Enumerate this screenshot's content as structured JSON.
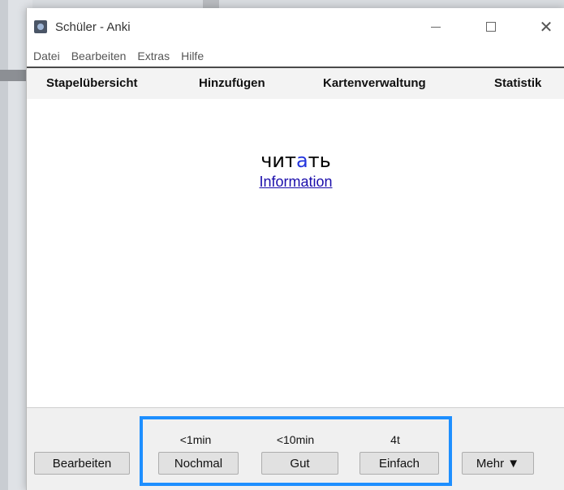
{
  "window": {
    "title": "Schüler - Anki"
  },
  "menu": [
    "Datei",
    "Bearbeiten",
    "Extras",
    "Hilfe"
  ],
  "toolbar": {
    "items": [
      "Stapelübersicht",
      "Hinzufügen",
      "Kartenverwaltung",
      "Statistik"
    ]
  },
  "card": {
    "word_prefix": "чит",
    "word_accent": "а",
    "word_suffix": "ть",
    "info_link": "Information",
    "accent_color": "#2233dd"
  },
  "answer": {
    "edit_label": "Bearbeiten",
    "more_label": "Mehr ▼",
    "options": [
      {
        "interval": "<1min",
        "label": "Nochmal"
      },
      {
        "interval": "<10min",
        "label": "Gut"
      },
      {
        "interval": "4t",
        "label": "Einfach"
      }
    ],
    "highlight_color": "#1e8fff"
  }
}
